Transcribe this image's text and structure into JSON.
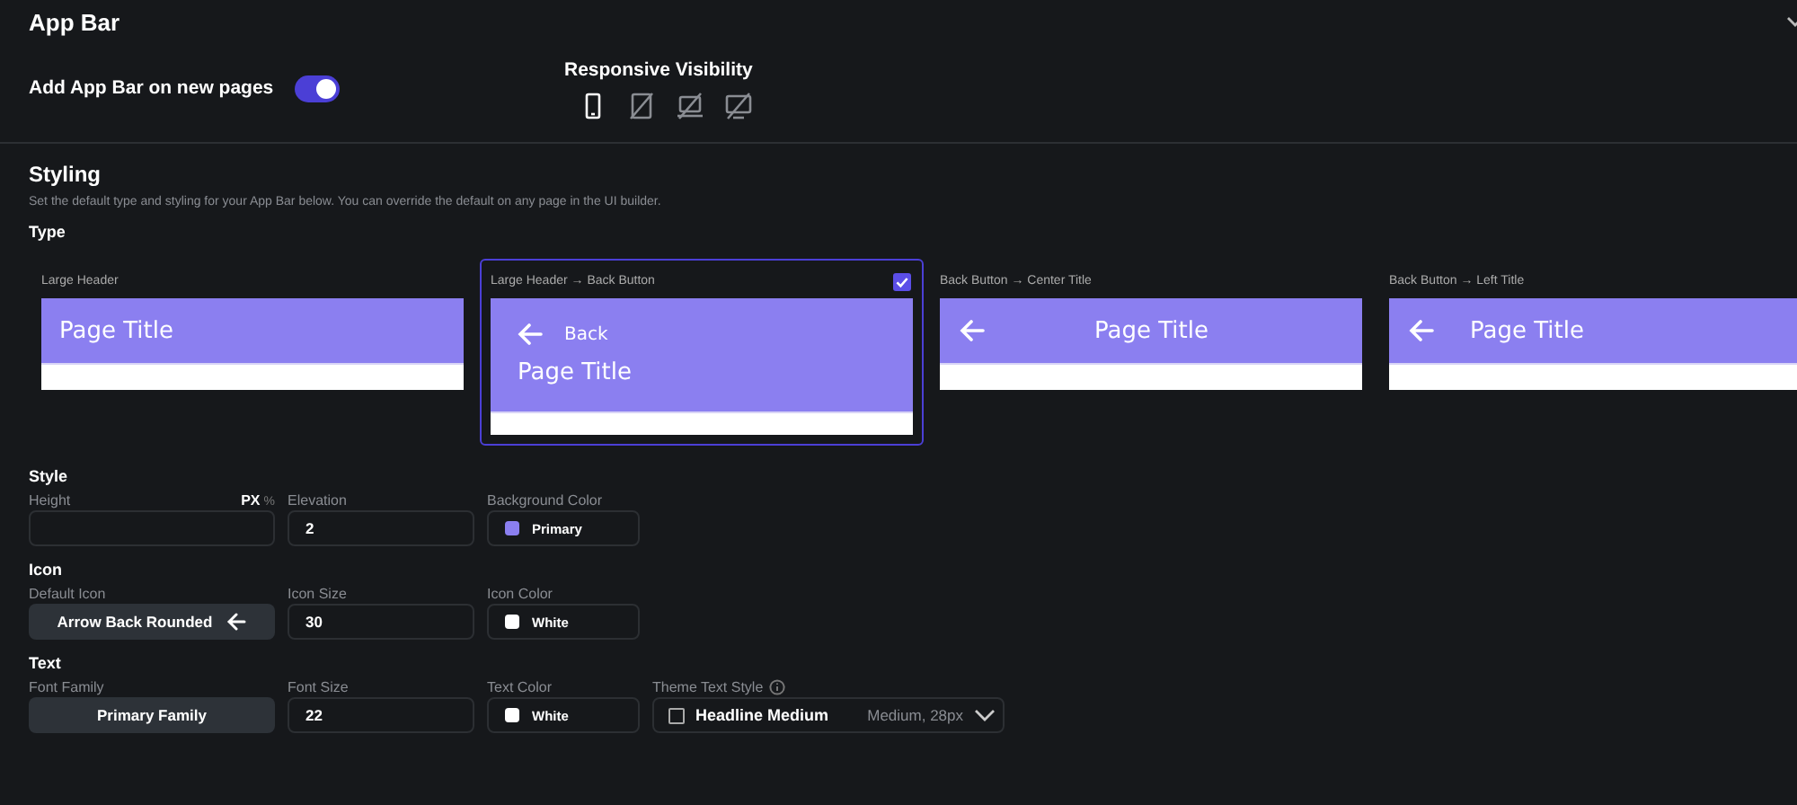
{
  "header": {
    "title": "App Bar"
  },
  "add_toggle": {
    "label": "Add App Bar on new pages",
    "on": true
  },
  "responsive_visibility": {
    "label": "Responsive Visibility",
    "devices": [
      {
        "kind": "phone",
        "selected": true
      },
      {
        "kind": "tablet",
        "selected": false
      },
      {
        "kind": "laptop",
        "selected": false
      },
      {
        "kind": "desktop",
        "selected": false
      }
    ]
  },
  "styling": {
    "title": "Styling",
    "description": "Set the default type and styling for your App Bar below. You can override the default on any page in the UI builder.",
    "type_label": "Type",
    "types": [
      {
        "label": "Large Header",
        "kind": "large-header",
        "selected": false,
        "title": "Page Title"
      },
      {
        "label": "Large Header → Back Button",
        "kind": "large-header-back",
        "selected": true,
        "back": "Back",
        "title": "Page Title"
      },
      {
        "label": "Back Button → Center Title",
        "kind": "back-center",
        "selected": false,
        "title": "Page Title"
      },
      {
        "label": "Back Button → Left Title",
        "kind": "back-left",
        "selected": false,
        "title": "Page Title"
      }
    ]
  },
  "sections": [
    {
      "title": "Style",
      "fields": [
        {
          "kind": "input",
          "label": "Height",
          "units": [
            {
              "label": "PX",
              "selected": true
            },
            {
              "label": "%",
              "selected": false
            }
          ]
        },
        {
          "kind": "input",
          "label": "Elevation",
          "value": "2"
        },
        {
          "kind": "color",
          "label": "Background Color",
          "value": "Primary",
          "color": "#8b7ff0"
        }
      ]
    },
    {
      "title": "Icon",
      "fields": [
        {
          "kind": "button",
          "label": "Default Icon",
          "value": "Arrow Back Rounded",
          "icon": true
        },
        {
          "kind": "input",
          "label": "Icon Size",
          "value": "30"
        },
        {
          "kind": "color",
          "label": "Icon Color",
          "value": "White",
          "color": "#ffffff"
        }
      ]
    },
    {
      "title": "Text",
      "fields": [
        {
          "kind": "button",
          "label": "Font Family",
          "value": "Primary Family"
        },
        {
          "kind": "input",
          "label": "Font Size",
          "value": "22"
        },
        {
          "kind": "color",
          "label": "Text Color",
          "value": "White",
          "color": "#ffffff"
        },
        {
          "kind": "select",
          "label": "Theme Text Style",
          "info": true,
          "checked": false,
          "value": "Headline Medium",
          "hint": "Medium, 28px"
        }
      ]
    }
  ]
}
